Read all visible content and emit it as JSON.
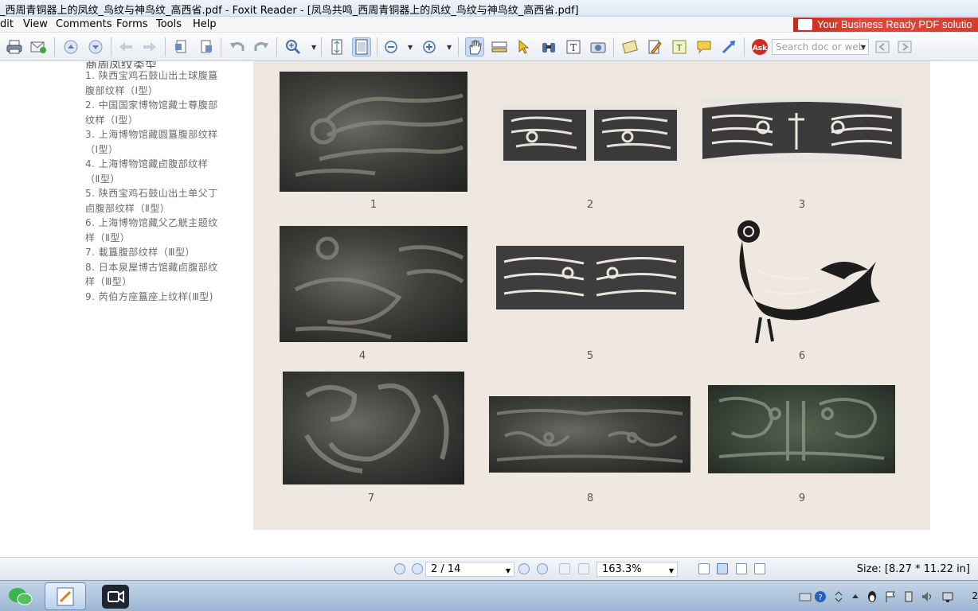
{
  "window": {
    "title": "_西周青铜器上的凤纹_鸟纹与神鸟纹_高西省.pdf - Foxit Reader - [凤鸟共鸣_西周青铜器上的凤纹_鸟纹与神鸟纹_高西省.pdf]"
  },
  "menu": {
    "items": [
      "dit",
      "View",
      "Comments",
      "Forms",
      "Tools",
      "Help"
    ],
    "banner": "Your Business Ready PDF solutio"
  },
  "toolbar": {
    "search_placeholder": "Search doc or web"
  },
  "document": {
    "heading": "商周凤纹类型",
    "captions": [
      "1. 陕西宝鸡石鼓山出土球腹簋",
      "腹部纹样（Ⅰ型）",
      "2. 中国国家博物馆藏士尊腹部",
      "纹样（Ⅰ型）",
      "3. 上海博物馆藏圆簋腹部纹样",
      "（Ⅰ型）",
      "4. 上海博物馆藏卣腹部纹样",
      "（Ⅱ型）",
      "5. 陕西宝鸡石鼓山出土单父丁",
      "卣腹部纹样（Ⅱ型）",
      "6. 上海博物馆藏父乙觥主题纹",
      "样（Ⅱ型）",
      "7. 載簋腹部纹样（Ⅲ型）",
      "8. 日本泉屋博古馆藏卣腹部纹",
      "样（Ⅲ型）",
      "9. 芮伯方座簋座上纹样(Ⅲ型)"
    ],
    "figures": [
      "1",
      "2",
      "3",
      "4",
      "5",
      "6",
      "7",
      "8",
      "9"
    ]
  },
  "statusbar": {
    "page_indicator": "2 / 14",
    "zoom": "163.3%",
    "size": "Size: [8.27 * 11.22 in]"
  },
  "taskbar": {
    "clock": "2"
  }
}
